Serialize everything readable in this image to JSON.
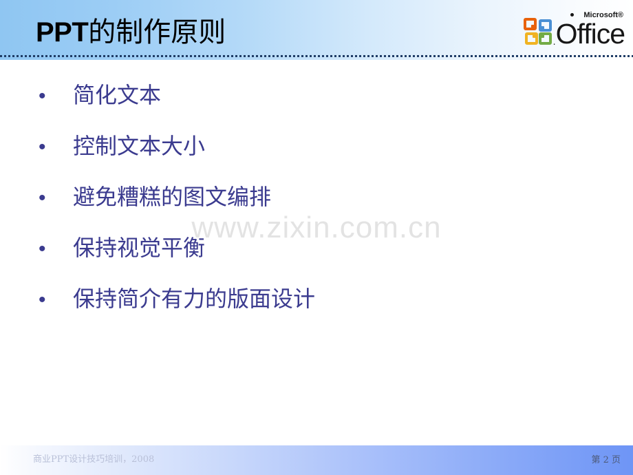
{
  "slide": {
    "title_latin": "PPT",
    "title_cjk": "的制作原则",
    "title_full": "PPT的制作原则"
  },
  "logo": {
    "brand_prefix": "Microsoft",
    "brand_registered": "®",
    "product_name": "Office",
    "leading_dot": ".",
    "quadrants": [
      {
        "name": "top-left",
        "color": "#e8620c"
      },
      {
        "name": "top-right",
        "color": "#4a8fd4"
      },
      {
        "name": "bottom-left",
        "color": "#f0b323"
      },
      {
        "name": "bottom-right",
        "color": "#73ab45"
      }
    ]
  },
  "body": {
    "bullet_glyph": "•",
    "bullets": [
      {
        "text": "简化文本"
      },
      {
        "text": "控制文本大小"
      },
      {
        "text": "避免糟糕的图文编排"
      },
      {
        "text": "保持视觉平衡"
      },
      {
        "text": "保持简介有力的版面设计"
      }
    ]
  },
  "watermark": {
    "text": "www.zixin.com.cn"
  },
  "footer": {
    "left_text": "商业PPT设计技巧培训，2008",
    "page_label": "第 2 页",
    "page_number": "2"
  },
  "colors": {
    "title_text": "#000000",
    "body_text": "#3b3b8f",
    "header_gradient_start": "#8fc6f2",
    "header_gradient_end": "#ffffff",
    "header_rule": "#1f3c66",
    "footer_gradient_start": "#ffffff",
    "footer_gradient_end": "#6e95f6",
    "watermark": "#e3e3e3",
    "footer_left_text": "#b9c0d8",
    "footer_page_text": "#4d5a78",
    "slide_background": "#ffffff"
  }
}
